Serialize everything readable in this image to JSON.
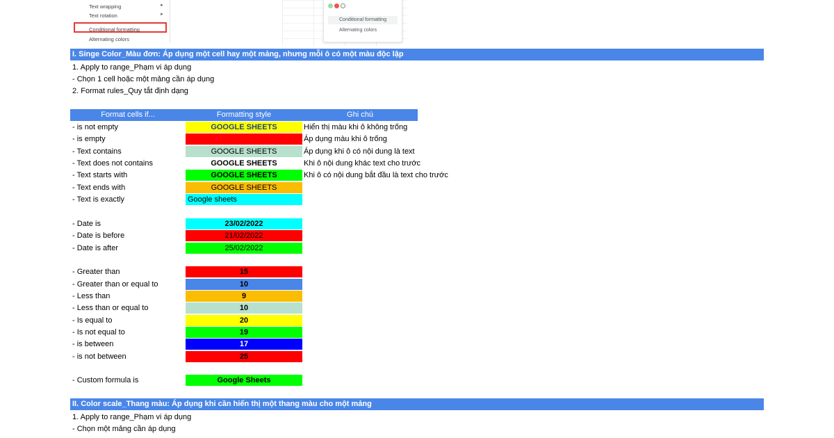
{
  "menu": {
    "items": [
      {
        "label": "Text wrapping",
        "has_submenu": true
      },
      {
        "label": "Text rotation",
        "has_submenu": true
      },
      {
        "label": "Conditional formatting",
        "has_submenu": false,
        "highlighted": true
      },
      {
        "label": "Alternating colors",
        "has_submenu": false
      }
    ],
    "arrow_glyph": "►"
  },
  "panel": {
    "items": [
      "Conditional formatting",
      "Alternating colors"
    ],
    "dot_colors": [
      "#a5d6a7",
      "#ef5350"
    ]
  },
  "section1": {
    "title": "I. Singe Color_Màu đơn: Áp dụng một cell hay một mảng, nhưng mỗi ô có một màu độc lập",
    "lines": [
      "1. Apply to range_Phạm vi áp dụng",
      "- Chọn 1 cell hoặc một mảng cần áp dụng",
      "2. Format rules_Quy tắt định dạng"
    ]
  },
  "table": {
    "headers": [
      "Format cells if...",
      "Formatting style",
      "Ghi chú"
    ],
    "rows": [
      {
        "label": "- is not empty",
        "value": "GOOGLE SHEETS",
        "bg": "#ffff00",
        "color": "#1c4587",
        "bold": true,
        "align": "center",
        "note": "Hiển thị màu khi ô không trống"
      },
      {
        "label": "- is empty",
        "value": "",
        "bg": "#ff0000",
        "color": "#000000",
        "bold": false,
        "align": "center",
        "note": "Áp dụng màu khi ô trống"
      },
      {
        "label": "- Text contains",
        "value": "GOOGLE SHEETS",
        "bg": "#b7e1cd",
        "color": "#000000",
        "bold": false,
        "align": "center",
        "note": "Áp dụng khi ô có nội dung là text"
      },
      {
        "label": "- Text does not contains",
        "value": "GOOGLE SHEETS",
        "bg": "#ffffff",
        "color": "#000000",
        "bold": true,
        "align": "center",
        "note": "Khi ô nội dung khác text cho trước"
      },
      {
        "label": "- Text starts with",
        "value": "GOOGLE SHEETS",
        "bg": "#00ff00",
        "color": "#000000",
        "bold": true,
        "align": "center",
        "note": "Khi ô có nội dung bắt đầu là text cho trước"
      },
      {
        "label": "- Text ends with",
        "value": "GOOGLE SHEETS",
        "bg": "#fbbc04",
        "color": "#000000",
        "bold": false,
        "align": "center",
        "note": ""
      },
      {
        "label": "- Text is exactly",
        "value": "Google sheets",
        "bg": "#00ffff",
        "color": "#000000",
        "bold": false,
        "align": "left",
        "note": ""
      },
      {
        "label": "",
        "value": "",
        "bg": "",
        "color": "",
        "bold": false,
        "align": "center",
        "note": ""
      },
      {
        "label": "- Date is",
        "value": "23/02/2022",
        "bg": "#00ffff",
        "color": "#000000",
        "bold": true,
        "align": "center",
        "note": ""
      },
      {
        "label": "- Date is before",
        "value": "21/02/2022",
        "bg": "#ff0000",
        "color": "#000000",
        "bold": false,
        "align": "center",
        "note": ""
      },
      {
        "label": "- Date is after",
        "value": "25/02/2022",
        "bg": "#00ff00",
        "color": "#000000",
        "bold": false,
        "align": "center",
        "note": ""
      },
      {
        "label": "",
        "value": "",
        "bg": "",
        "color": "",
        "bold": false,
        "align": "center",
        "note": ""
      },
      {
        "label": "- Greater than",
        "value": "15",
        "bg": "#ff0000",
        "color": "#000000",
        "bold": true,
        "align": "center",
        "note": ""
      },
      {
        "label": "- Greater than or equal to",
        "value": "10",
        "bg": "#4a86e8",
        "color": "#000000",
        "bold": true,
        "align": "center",
        "note": ""
      },
      {
        "label": "- Less than",
        "value": "9",
        "bg": "#fbbc04",
        "color": "#000000",
        "bold": true,
        "align": "center",
        "note": ""
      },
      {
        "label": "- Less than or equal to",
        "value": "10",
        "bg": "#b7e1cd",
        "color": "#000000",
        "bold": true,
        "align": "center",
        "note": ""
      },
      {
        "label": "- Is equal to",
        "value": "20",
        "bg": "#ffff00",
        "color": "#000000",
        "bold": true,
        "align": "center",
        "note": ""
      },
      {
        "label": "- Is not equal to",
        "value": "19",
        "bg": "#00ff00",
        "color": "#000000",
        "bold": true,
        "align": "center",
        "note": ""
      },
      {
        "label": "- is between",
        "value": "17",
        "bg": "#0000ff",
        "color": "#ffffff",
        "bold": true,
        "align": "center",
        "note": ""
      },
      {
        "label": "- is not between",
        "value": "25",
        "bg": "#ff0000",
        "color": "#000000",
        "bold": true,
        "align": "center",
        "note": ""
      },
      {
        "label": "",
        "value": "",
        "bg": "",
        "color": "",
        "bold": false,
        "align": "center",
        "note": ""
      },
      {
        "label": "- Custom formula is",
        "value": "Google Sheets",
        "bg": "#00ff00",
        "color": "#000000",
        "bold": true,
        "align": "center",
        "note": ""
      }
    ]
  },
  "section2": {
    "title": "II. Color scale_Thang màu: Áp dụng khi cần hiển thị một thang màu cho một mảng",
    "lines": [
      "1. Apply to range_Phạm vi áp dụng",
      "- Chọn một mảng cần áp dụng"
    ]
  }
}
